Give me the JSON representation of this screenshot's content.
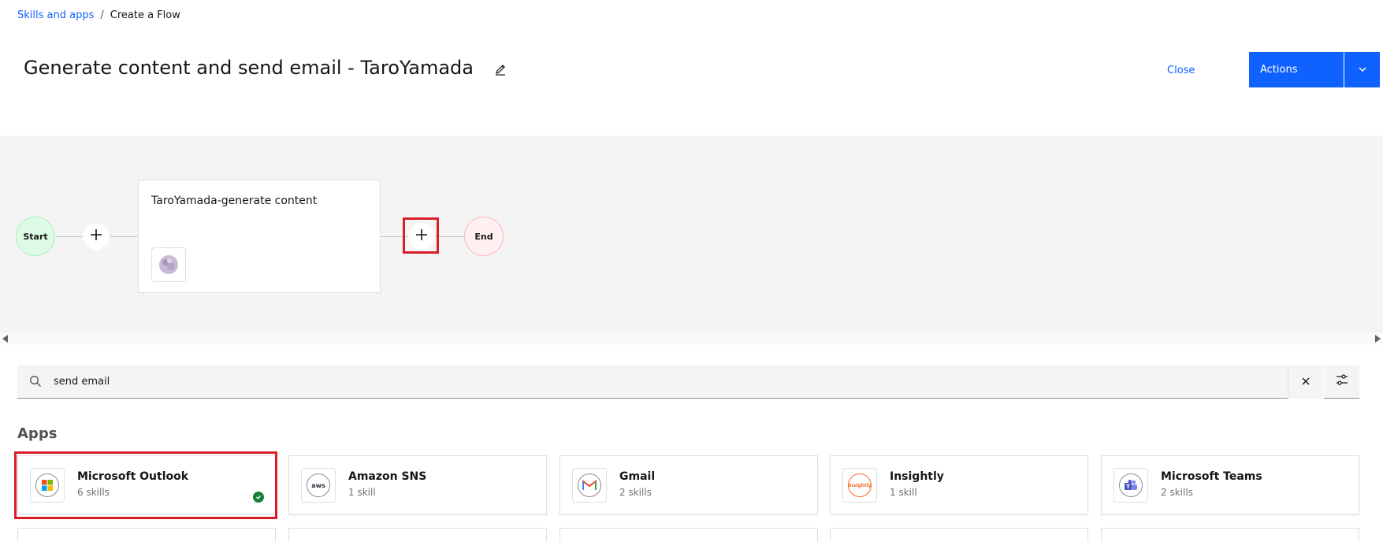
{
  "breadcrumb": {
    "parent": "Skills and apps",
    "separator": "/",
    "current": "Create a Flow"
  },
  "header": {
    "title": "Generate content and send email - TaroYamada",
    "close_label": "Close",
    "actions_label": "Actions"
  },
  "flow": {
    "start_label": "Start",
    "end_label": "End",
    "step_title": "TaroYamada-generate content"
  },
  "search": {
    "value": "send email",
    "placeholder": ""
  },
  "apps": {
    "heading": "Apps",
    "items": [
      {
        "name": "Microsoft Outlook",
        "count": "6 skills",
        "icon": "microsoft-outlook-icon",
        "selected": true
      },
      {
        "name": "Amazon SNS",
        "count": "1 skill",
        "icon": "amazon-sns-icon",
        "selected": false
      },
      {
        "name": "Gmail",
        "count": "2 skills",
        "icon": "gmail-icon",
        "selected": false
      },
      {
        "name": "Insightly",
        "count": "1 skill",
        "icon": "insightly-icon",
        "selected": false
      },
      {
        "name": "Microsoft Teams",
        "count": "2 skills",
        "icon": "microsoft-teams-icon",
        "selected": false
      }
    ],
    "aws_logo_text": "aws",
    "insightly_logo_text": "insightly"
  },
  "colors": {
    "primary": "#0f62fe",
    "highlight": "#da1e28",
    "start_bg": "#defbe6",
    "end_bg": "#fff1f1",
    "check": "#198038"
  }
}
